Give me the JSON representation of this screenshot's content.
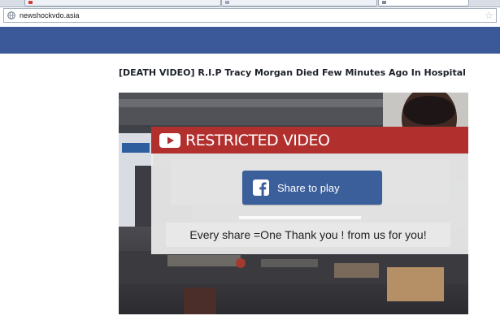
{
  "browser": {
    "url": "newshockvdo.asia"
  },
  "colors": {
    "facebook_blue": "#3b5998",
    "restricted_red": "#b1302e",
    "share_button": "#3b5f9a"
  },
  "icons": {
    "site": "globe-icon",
    "bookmark": "star-icon",
    "banner": "youtube-play-icon",
    "share": "facebook-icon"
  },
  "article": {
    "title": "[DEATH VIDEO] R.I.P Tracy Morgan Died Few Minutes Ago In Hospital"
  },
  "video": {
    "banner_title": "RESTRICTED VIDEO",
    "share_label": "Share to play",
    "message": "Every share =One Thank you ! from us for you!"
  }
}
